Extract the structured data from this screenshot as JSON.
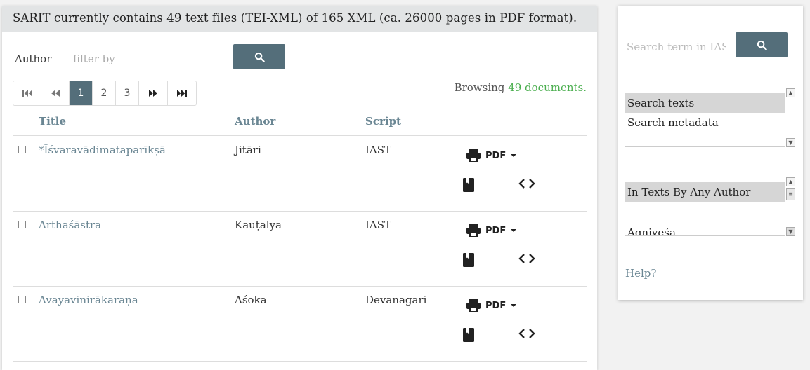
{
  "banner": "SARIT currently contains 49 text files (TEI-XML) of 165 XML (ca. 26000 pages in PDF format).",
  "filter": {
    "field_label": "Author",
    "placeholder": "filter by"
  },
  "pagination": {
    "pages": [
      "1",
      "2",
      "3"
    ],
    "active_page": "1"
  },
  "browsing": {
    "prefix": "Browsing",
    "count_text": "49 documents."
  },
  "table": {
    "headers": {
      "title": "Title",
      "author": "Author",
      "script": "Script"
    },
    "rows": [
      {
        "title": "*Īśvaravādimataparīkṣā",
        "author": "Jitāri",
        "script": "IAST",
        "pdf_label": "PDF"
      },
      {
        "title": "Arthaśāstra",
        "author": "Kauṭalya",
        "script": "IAST",
        "pdf_label": "PDF"
      },
      {
        "title": "Avayavinirākaraṇa",
        "author": "Aśoka",
        "script": "Devanagari",
        "pdf_label": "PDF"
      }
    ]
  },
  "sidebar": {
    "search_placeholder": "Search term in IAST",
    "search_modes": [
      "Search texts",
      "Search metadata"
    ],
    "selected_mode": "Search texts",
    "author_options": [
      "In Texts By Any Author",
      "Agniveśa"
    ],
    "selected_author": "In Texts By Any Author",
    "help_label": "Help?"
  },
  "icons": {
    "search": "search-icon",
    "first": "first-page-icon",
    "prev": "previous-page-icon",
    "next": "next-page-icon",
    "last": "last-page-icon",
    "print": "print-icon",
    "dropdown": "caret-down-icon",
    "book": "book-icon",
    "code": "code-icon"
  },
  "colors": {
    "accent": "#546e7a",
    "link": "#6a8693",
    "count": "#4caf50",
    "banner_bg": "#e2e4e5"
  }
}
